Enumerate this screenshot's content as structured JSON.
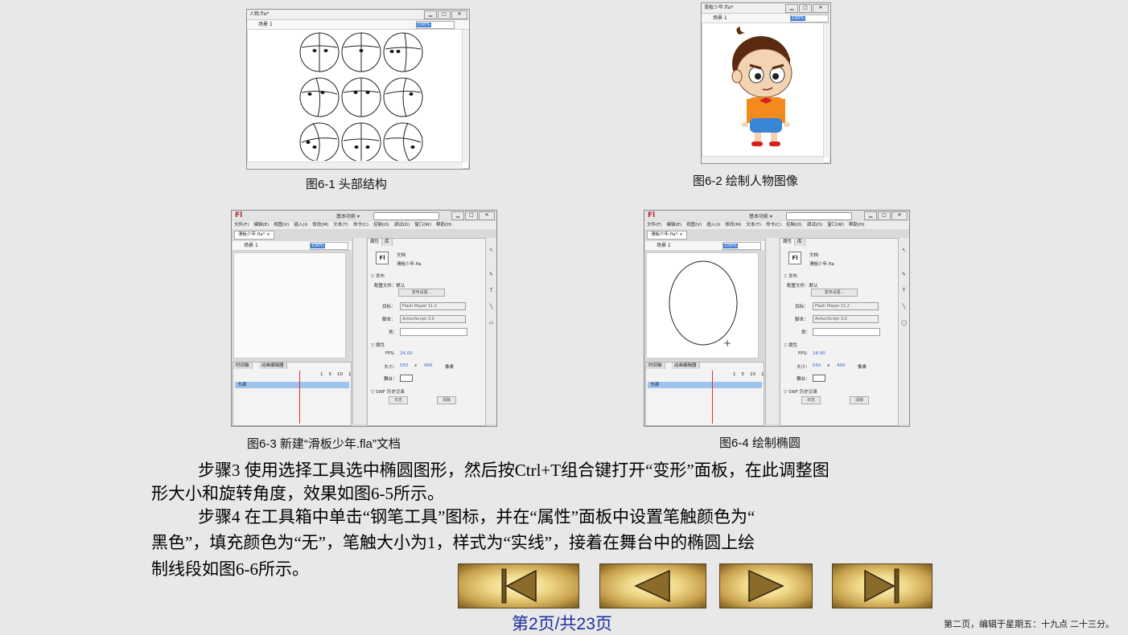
{
  "fig1": {
    "window_title": "人物.fla*",
    "scene": "场景 1",
    "zoom": "100%",
    "caption": "图6-1  头部结构"
  },
  "fig2": {
    "window_title": "滑板少年.fla*",
    "scene": "场景 1",
    "zoom": "100%",
    "caption": "图6-2  绘制人物图像"
  },
  "flash_ui": {
    "logo": "Fl",
    "workspace": "基本功能 ▾",
    "menu": [
      "文件(F)",
      "编辑(E)",
      "视图(V)",
      "插入(I)",
      "修改(M)",
      "文本(T)",
      "命令(C)",
      "控制(O)",
      "调试(D)",
      "窗口(W)",
      "帮助(H)"
    ],
    "doc_tab": "滑板少年.fla* ×",
    "scene": "场景 1",
    "zoom": "100%",
    "panel_tabs": [
      "属性",
      "库"
    ],
    "doc_label": "文档",
    "doc_file": "滑板少年.fla",
    "publish_section": "▽ 发布",
    "profile_label": "配置文件：默认",
    "publish_settings_btn": "发布设置...",
    "target_label": "目标：",
    "target_value": "Flash Player 11.2",
    "script_label": "脚本：",
    "script_value": "ActionScript 3.0",
    "class_label": "类：",
    "props_section": "▽ 属性",
    "fps_label": "FPS:",
    "fps_value": "24.00",
    "size_label": "大小：",
    "width": "550",
    "x_sep": "x",
    "height": "400",
    "unit": "像素",
    "stage_label": "舞台：",
    "swf_section": "▽ SWF 历史记录",
    "log_btn": "日志",
    "clear_btn": "清除",
    "timeline_tabs": [
      "时间轴",
      "动画编辑器"
    ],
    "layer_name": "头部",
    "frame_marks": [
      "1",
      "5",
      "10",
      "1"
    ]
  },
  "fig3_caption": "图6-3  新建“滑板少年.fla”文档",
  "fig4_caption": "图6-4  绘制椭圆",
  "body": {
    "line1": "步骤3  使用选择工具选中椭圆图形，然后按Ctrl+T组合键打开“变形”面板，在此调整图",
    "line2": "形大小和旋转角度，效果如图6-5所示。",
    "line3": "步骤4  在工具箱中单击“钢笔工具”图标，并在“属性”面板中设置笔触颜色为“",
    "line4": "黑色”，填充颜色为“无”，笔触大小为1，样式为“实线”，接着在舞台中的椭圆上绘",
    "line5": "制线段如图6-6所示。"
  },
  "nav": {
    "first_icon": "first-page-icon",
    "prev_icon": "previous-page-icon",
    "next_icon": "next-page-icon",
    "last_icon": "last-page-icon"
  },
  "footer": {
    "page": "第2页/共23页",
    "note": "第二页，编辑于星期五：十九点 二十三分。"
  },
  "colors": {
    "accent_blue": "#1d2e9e",
    "nav_gold": "#d4b25c",
    "selection_blue": "#3f7fd6"
  }
}
